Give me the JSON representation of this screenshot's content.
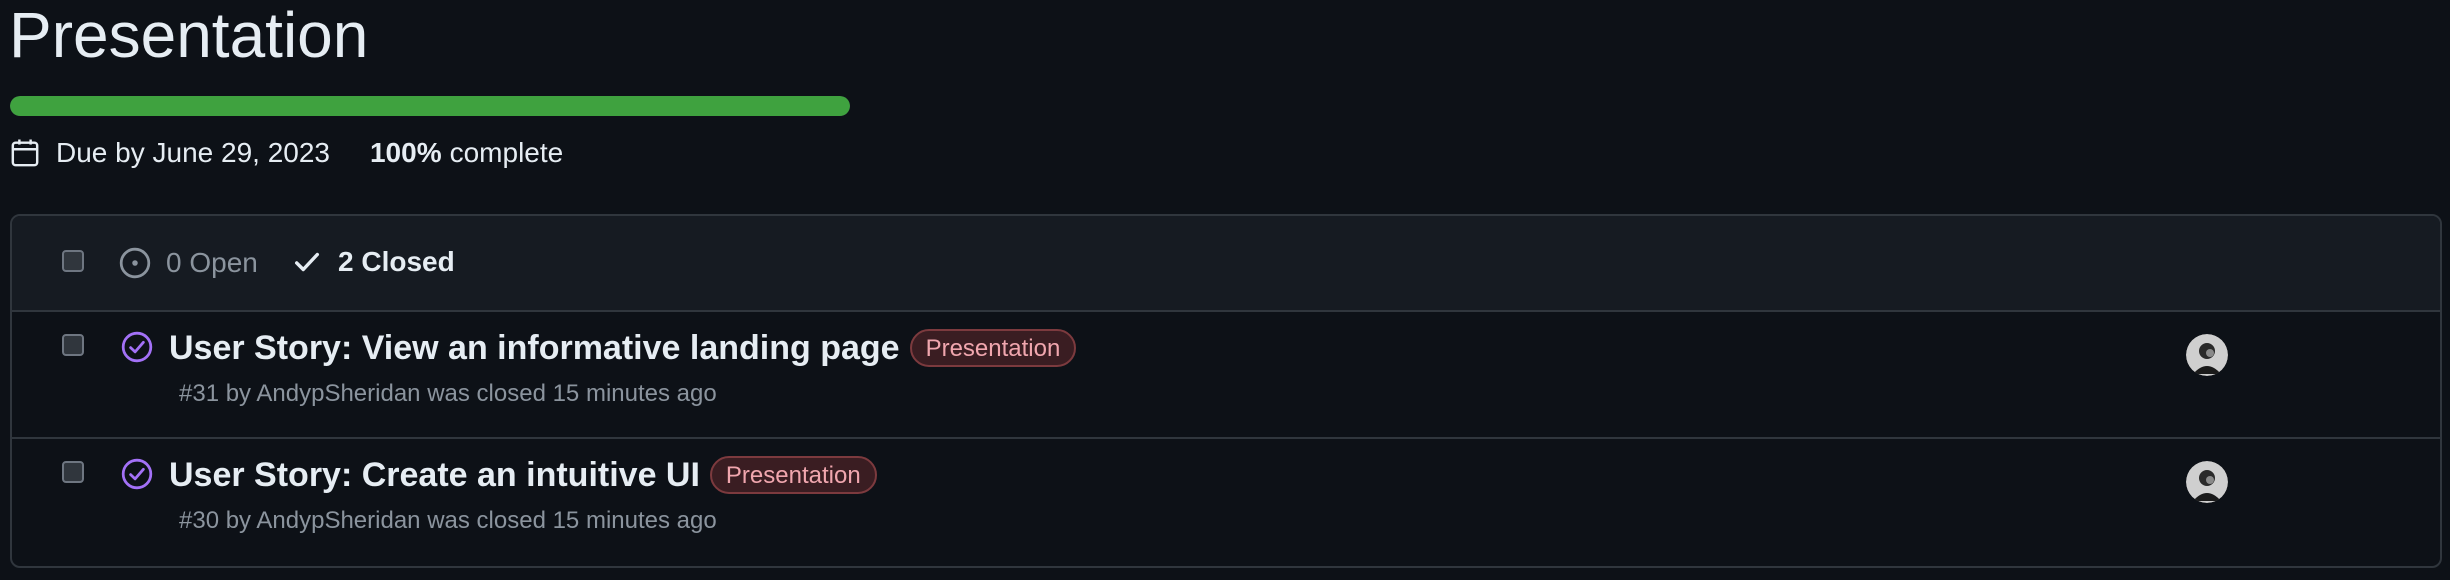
{
  "milestone": {
    "title": "Presentation",
    "progress_percent": 100,
    "due_text": "Due by June 29, 2023",
    "percent_value": "100%",
    "percent_suffix": "complete"
  },
  "filters": {
    "open_label": "0 Open",
    "closed_label": "2 Closed"
  },
  "issues": [
    {
      "title": "User Story: View an informative landing page",
      "label": "Presentation",
      "meta": "#31 by AndypSheridan was closed 15 minutes ago",
      "status": "closed"
    },
    {
      "title": "User Story: Create an intuitive UI",
      "label": "Presentation",
      "meta": "#30 by AndypSheridan was closed 15 minutes ago",
      "status": "closed"
    }
  ],
  "colors": {
    "progress": "#3fa23f",
    "closed_icon": "#a371f7",
    "label_text": "#f0a6ae",
    "label_border": "#7c3a3e"
  },
  "icons": {
    "due": "calendar-icon",
    "open": "issue-open-icon",
    "closed": "check-icon",
    "issue_status": "issue-closed-icon"
  }
}
